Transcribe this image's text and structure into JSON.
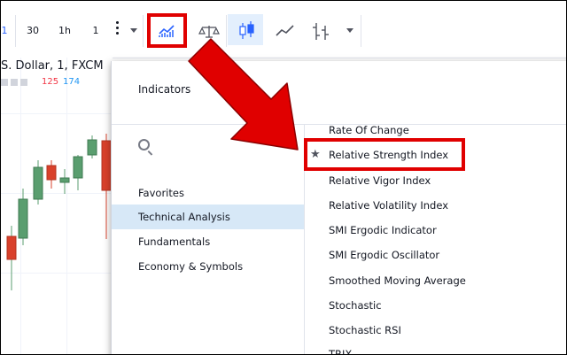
{
  "toolbar": {
    "interval_partial": "1",
    "interval_30": "30",
    "interval_1h": "1h",
    "interval_1": "1",
    "indicators_icon": "indicators-icon",
    "compare_icon": "scales-icon",
    "candles_icon": "candlestick-icon",
    "line_icon": "area-line-icon",
    "bars_icon": "bars-icon"
  },
  "chart": {
    "title": "S. Dollar, 1, FXCM",
    "value_red": "125",
    "value_blue": "174",
    "colors": {
      "up": "#5a9e6f",
      "down": "#d9412b"
    }
  },
  "dialog": {
    "title": "Indicators",
    "categories": [
      {
        "label": "Favorites"
      },
      {
        "label": "Technical Analysis"
      },
      {
        "label": "Fundamentals"
      },
      {
        "label": "Economy & Symbols"
      }
    ],
    "items": [
      "Rate Of Change",
      "Relative Strength Index",
      "Relative Vigor Index",
      "Relative Volatility Index",
      "SMI Ergodic Indicator",
      "SMI Ergodic Oscillator",
      "Smoothed Moving Average",
      "Stochastic",
      "Stochastic RSI",
      "TRIX"
    ]
  },
  "colors": {
    "highlight": "#e00000",
    "accent": "#2962ff",
    "selected_bg": "#d7e8f7"
  }
}
